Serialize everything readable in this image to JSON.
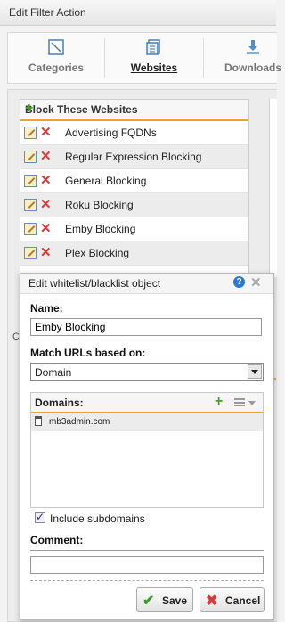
{
  "window": {
    "title": "Edit Filter Action"
  },
  "tabs": [
    {
      "label": "Categories",
      "icon": "categories-icon"
    },
    {
      "label": "Websites",
      "icon": "websites-icon",
      "active": true
    },
    {
      "label": "Downloads",
      "icon": "downloads-icon"
    }
  ],
  "block_panel": {
    "title": "Block These Websites",
    "items": [
      {
        "label": "Advertising FQDNs"
      },
      {
        "label": "Regular Expression Blocking"
      },
      {
        "label": "General Blocking"
      },
      {
        "label": "Roku Blocking"
      },
      {
        "label": "Emby Blocking"
      },
      {
        "label": "Plex Blocking"
      }
    ]
  },
  "background_label": "C",
  "dialog": {
    "title": "Edit whitelist/blacklist object",
    "name_label": "Name:",
    "name_value": "Emby Blocking",
    "match_label": "Match URLs based on:",
    "match_value": "Domain",
    "domains_label": "Domains:",
    "domains": [
      "mb3admin.com"
    ],
    "include_subdomains_label": "Include subdomains",
    "include_subdomains_checked": true,
    "comment_label": "Comment:",
    "comment_value": "",
    "save_label": "Save",
    "cancel_label": "Cancel"
  },
  "colors": {
    "accent": "#f0a030",
    "add": "#4aa02c",
    "delete": "#d63a3a",
    "help": "#2a7ad0"
  }
}
